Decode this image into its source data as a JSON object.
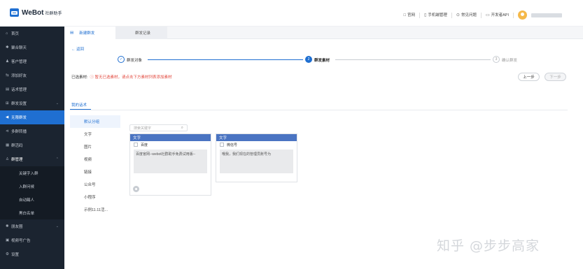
{
  "brand": {
    "name": "WeBot",
    "subtitle": "社群助手"
  },
  "topnav": [
    {
      "icon": "□",
      "label": "官网"
    },
    {
      "icon": "▯",
      "label": "手机端管理"
    },
    {
      "icon": "⊙",
      "label": "常见问题"
    },
    {
      "icon": "▭",
      "label": "开发者API"
    }
  ],
  "sidebar": {
    "items": [
      {
        "icon": "⌂",
        "label": "首页"
      },
      {
        "icon": "✱",
        "label": "聚合聊天"
      },
      {
        "icon": "♟",
        "label": "客户管理"
      },
      {
        "icon": "⇆",
        "label": "添加好友"
      },
      {
        "icon": "▤",
        "label": "话术管理"
      },
      {
        "icon": "⊞",
        "label": "群发设置"
      },
      {
        "icon": "◀",
        "label": "无限群发"
      },
      {
        "icon": "⊲",
        "label": "多群转播"
      },
      {
        "icon": "▦",
        "label": "群活码"
      },
      {
        "icon": "♙",
        "label": "群管理"
      },
      {
        "label": "关键字入群"
      },
      {
        "label": "入群问候"
      },
      {
        "label": "自动踢人"
      },
      {
        "label": "黑白名单"
      },
      {
        "icon": "✺",
        "label": "朋友圈"
      },
      {
        "icon": "▣",
        "label": "视频号广告"
      },
      {
        "icon": "⚙",
        "label": "设置"
      }
    ]
  },
  "tabs": [
    {
      "icon": "▤",
      "label": "新建群发"
    },
    {
      "label": "群发记录"
    }
  ],
  "back_label": "← 返回",
  "steps": [
    {
      "marker": "✓",
      "label": "群发对象"
    },
    {
      "marker": "2",
      "label": "群发素材"
    },
    {
      "marker": "3",
      "label": "确认群发"
    }
  ],
  "selected": {
    "label": "已选素材:",
    "warning": "ⓘ 暂无已选素材，请点击下方素材列表添加素材"
  },
  "buttons": {
    "prev": "上一步",
    "next": "下一步"
  },
  "panel_tab": "我的话术",
  "categories": [
    "默认分组",
    "文字",
    "图片",
    "视频",
    "链接",
    "公众号",
    "小程序",
    "示例11.11活..."
  ],
  "search_placeholder": "搜索关键字",
  "cards": [
    {
      "header": "文字",
      "title": "百度",
      "content": "百度官网--webot社群助手免费试用版--"
    },
    {
      "header": "文字",
      "title": "微信号",
      "content": "哦我，我们现在的管理员账号为"
    }
  ],
  "watermark": "知乎 @步步高家"
}
